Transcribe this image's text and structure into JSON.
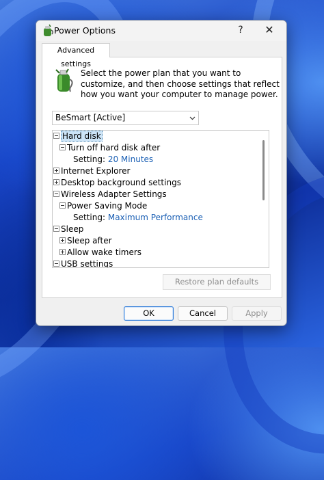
{
  "window": {
    "title": "Power Options",
    "help_label": "?",
    "close_label": "✕"
  },
  "tab": {
    "label": "Advanced settings"
  },
  "instructions": "Select the power plan that you want to customize, and then choose settings that reflect how you want your computer to manage power.",
  "plan_select": {
    "value": "BeSmart [Active]"
  },
  "tree": {
    "rows": [
      {
        "text": "Hard disk",
        "expander": "minus",
        "selected": true
      },
      {
        "text": "Turn off hard disk after",
        "expander": "minus"
      },
      {
        "label": "Setting:",
        "value": "20 Minutes"
      },
      {
        "text": "Internet Explorer",
        "expander": "plus"
      },
      {
        "text": "Desktop background settings",
        "expander": "plus"
      },
      {
        "text": "Wireless Adapter Settings",
        "expander": "minus"
      },
      {
        "text": "Power Saving Mode",
        "expander": "minus"
      },
      {
        "label": "Setting:",
        "value": "Maximum Performance"
      },
      {
        "text": "Sleep",
        "expander": "minus"
      },
      {
        "text": "Sleep after",
        "expander": "plus"
      },
      {
        "text": "Allow wake timers",
        "expander": "plus"
      },
      {
        "text": "USB settings",
        "expander": "minus"
      }
    ]
  },
  "buttons": {
    "restore": "Restore plan defaults",
    "ok": "OK",
    "cancel": "Cancel",
    "apply": "Apply"
  },
  "colors": {
    "setting_value": "#1a5fb4",
    "selection": "#cce4f7",
    "ok_border": "#2b79d8"
  }
}
